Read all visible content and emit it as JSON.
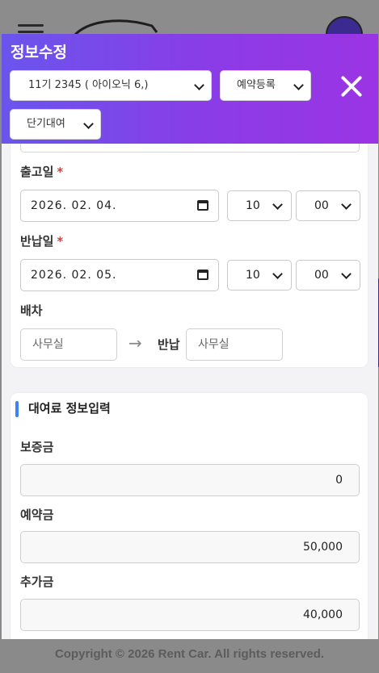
{
  "modal": {
    "title": "정보수정",
    "car_select": "11기 2345 ( 아이오닉 6,)",
    "type_select": "예약등록",
    "rental_select": "단기대여"
  },
  "schedule": {
    "out_label": "출고일",
    "out_date": "2026. 02. 04.",
    "out_hour": "10",
    "out_minute": "00",
    "return_label": "반납일",
    "return_date": "2026. 02. 05.",
    "return_hour": "10",
    "return_minute": "00",
    "required_mark": "*",
    "dispatch_label": "배차",
    "dispatch_place": "사무실",
    "arrow": "→",
    "return_place_label": "반납",
    "return_place": "사무실"
  },
  "fee": {
    "section_title": "대여료 정보입력",
    "deposit_label": "보증금",
    "deposit_value": "0",
    "reservation_label": "예약금",
    "reservation_value": "50,000",
    "additional_label": "추가금",
    "additional_value": "40,000"
  },
  "footer": {
    "copyright": "Copyright © 2026 Rent Car. All rights reserved."
  }
}
